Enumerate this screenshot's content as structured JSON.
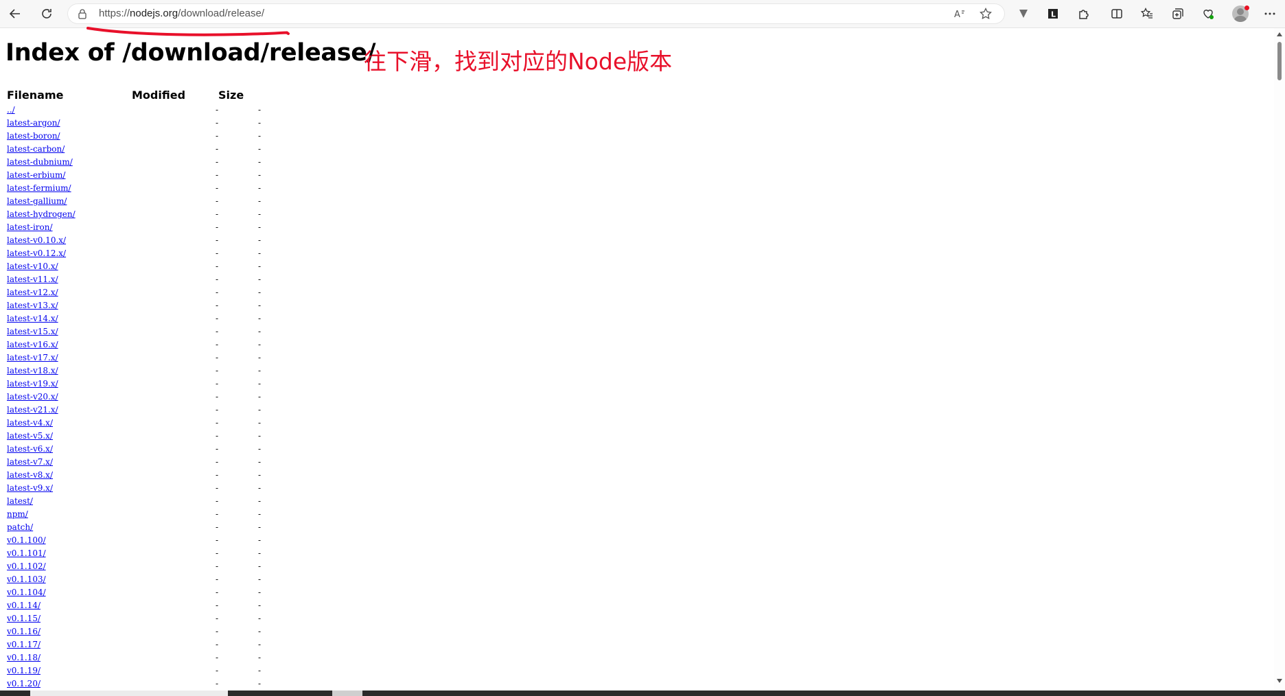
{
  "browser": {
    "url_protocol": "https://",
    "url_host": "nodejs.org",
    "url_path": "/download/release/"
  },
  "page": {
    "title": "Index of /download/release/",
    "annotation": "往下滑，找到对应的Node版本",
    "columns": {
      "filename": "Filename",
      "modified": "Modified",
      "size": "Size"
    },
    "rows": [
      {
        "name": "../",
        "modified": "-",
        "size": "-"
      },
      {
        "name": "latest-argon/",
        "modified": "-",
        "size": "-"
      },
      {
        "name": "latest-boron/",
        "modified": "-",
        "size": "-"
      },
      {
        "name": "latest-carbon/",
        "modified": "-",
        "size": "-"
      },
      {
        "name": "latest-dubnium/",
        "modified": "-",
        "size": "-"
      },
      {
        "name": "latest-erbium/",
        "modified": "-",
        "size": "-"
      },
      {
        "name": "latest-fermium/",
        "modified": "-",
        "size": "-"
      },
      {
        "name": "latest-gallium/",
        "modified": "-",
        "size": "-"
      },
      {
        "name": "latest-hydrogen/",
        "modified": "-",
        "size": "-"
      },
      {
        "name": "latest-iron/",
        "modified": "-",
        "size": "-"
      },
      {
        "name": "latest-v0.10.x/",
        "modified": "-",
        "size": "-"
      },
      {
        "name": "latest-v0.12.x/",
        "modified": "-",
        "size": "-"
      },
      {
        "name": "latest-v10.x/",
        "modified": "-",
        "size": "-"
      },
      {
        "name": "latest-v11.x/",
        "modified": "-",
        "size": "-"
      },
      {
        "name": "latest-v12.x/",
        "modified": "-",
        "size": "-"
      },
      {
        "name": "latest-v13.x/",
        "modified": "-",
        "size": "-"
      },
      {
        "name": "latest-v14.x/",
        "modified": "-",
        "size": "-"
      },
      {
        "name": "latest-v15.x/",
        "modified": "-",
        "size": "-"
      },
      {
        "name": "latest-v16.x/",
        "modified": "-",
        "size": "-"
      },
      {
        "name": "latest-v17.x/",
        "modified": "-",
        "size": "-"
      },
      {
        "name": "latest-v18.x/",
        "modified": "-",
        "size": "-"
      },
      {
        "name": "latest-v19.x/",
        "modified": "-",
        "size": "-"
      },
      {
        "name": "latest-v20.x/",
        "modified": "-",
        "size": "-"
      },
      {
        "name": "latest-v21.x/",
        "modified": "-",
        "size": "-"
      },
      {
        "name": "latest-v4.x/",
        "modified": "-",
        "size": "-"
      },
      {
        "name": "latest-v5.x/",
        "modified": "-",
        "size": "-"
      },
      {
        "name": "latest-v6.x/",
        "modified": "-",
        "size": "-"
      },
      {
        "name": "latest-v7.x/",
        "modified": "-",
        "size": "-"
      },
      {
        "name": "latest-v8.x/",
        "modified": "-",
        "size": "-"
      },
      {
        "name": "latest-v9.x/",
        "modified": "-",
        "size": "-"
      },
      {
        "name": "latest/",
        "modified": "-",
        "size": "-"
      },
      {
        "name": "npm/",
        "modified": "-",
        "size": "-"
      },
      {
        "name": "patch/",
        "modified": "-",
        "size": "-"
      },
      {
        "name": "v0.1.100/",
        "modified": "-",
        "size": "-"
      },
      {
        "name": "v0.1.101/",
        "modified": "-",
        "size": "-"
      },
      {
        "name": "v0.1.102/",
        "modified": "-",
        "size": "-"
      },
      {
        "name": "v0.1.103/",
        "modified": "-",
        "size": "-"
      },
      {
        "name": "v0.1.104/",
        "modified": "-",
        "size": "-"
      },
      {
        "name": "v0.1.14/",
        "modified": "-",
        "size": "-"
      },
      {
        "name": "v0.1.15/",
        "modified": "-",
        "size": "-"
      },
      {
        "name": "v0.1.16/",
        "modified": "-",
        "size": "-"
      },
      {
        "name": "v0.1.17/",
        "modified": "-",
        "size": "-"
      },
      {
        "name": "v0.1.18/",
        "modified": "-",
        "size": "-"
      },
      {
        "name": "v0.1.19/",
        "modified": "-",
        "size": "-"
      },
      {
        "name": "v0.1.20/",
        "modified": "-",
        "size": "-"
      }
    ]
  },
  "colors": {
    "link": "#0000ee",
    "annotation": "#e8102a"
  }
}
